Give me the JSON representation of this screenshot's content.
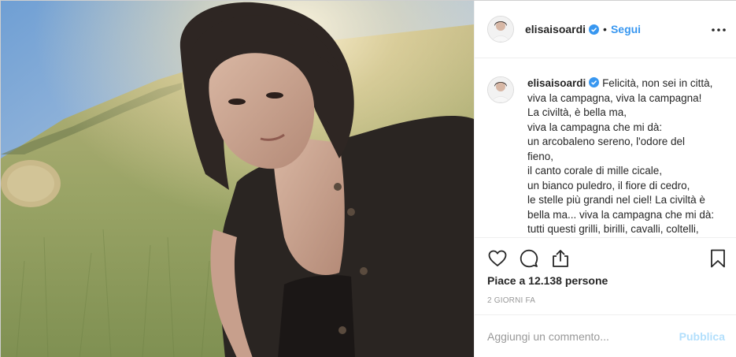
{
  "post": {
    "username": "elisaisoardi",
    "dot": "•",
    "follow_label": "Segui",
    "icons": {
      "avatar": "avatar",
      "verified": "verified-badge-icon",
      "more": "more-options-icon",
      "like": "heart-icon",
      "comment": "comment-icon",
      "share": "share-icon",
      "save": "bookmark-icon"
    },
    "caption": {
      "username": "elisaisoardi",
      "lines": [
        "Felicità, non sei in città,",
        "viva la campagna, viva la campagna!",
        "La civiltà, è bella ma,",
        "viva la campagna che mi dà:",
        "un arcobaleno sereno, l'odore del",
        "fieno,",
        "il canto corale di mille cicale,",
        "un bianco puledro, il fiore di cedro,",
        "le stelle più grandi nel ciel! La civiltà è",
        "bella ma... viva la campagna che mi dà:",
        "tutti questi grilli, birilli, cavalli, coltelli,"
      ]
    },
    "likes": "Piace a 12.138 persone",
    "timestamp": "2 GIORNI FA",
    "comment_placeholder": "Aggiungi un commento...",
    "publish_label": "Pubblica"
  },
  "colors": {
    "link_blue": "#3897f0",
    "publish_disabled": "#b2dffc",
    "muted": "#999999"
  }
}
